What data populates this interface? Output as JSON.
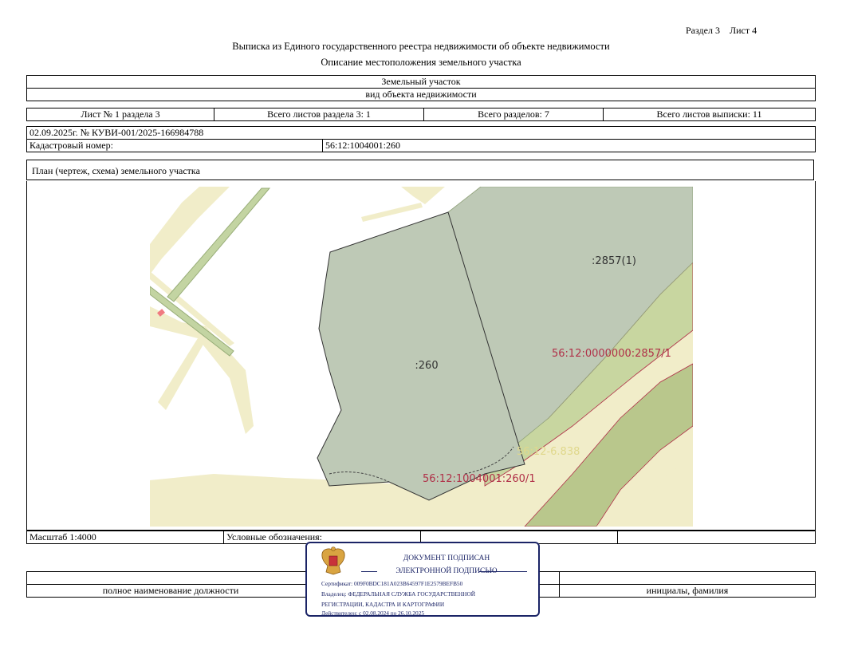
{
  "header": {
    "section": "Раздел 3",
    "sheet": "Лист 4",
    "title": "Выписка из Единого государственного реестра недвижимости об объекте недвижимости",
    "subtitle": "Описание местоположения земельного участка"
  },
  "object": {
    "type": "Земельный участок",
    "type_caption": "вид объекта недвижимости"
  },
  "sheets": {
    "sheet_of_section": "Лист № 1 раздела 3",
    "total_sheets_section": "Всего листов раздела 3: 1",
    "total_sections": "Всего разделов: 7",
    "total_sheets_extract": "Всего листов выписки: 11"
  },
  "record": {
    "date_number": "02.09.2025г. № КУВИ-001/2025-166984788",
    "cadastral_label": "Кадастровый номер:",
    "cadastral_value": "56:12:1004001:260"
  },
  "plan": {
    "title": "План (чертеж, схема) земельного участка",
    "labels": {
      "parcel": ":260",
      "neighbor": ":2857(1)",
      "zone_big": "56:12:0000000:2857/1",
      "zone_small": "56:12-6.838",
      "zone_parcel": "56:12:1004001:260/1"
    },
    "colors": {
      "parcel_fill": "#bec9b6",
      "road_fill": "#efebc6",
      "green_band": "#c8d6a0",
      "label_red": "#b03048",
      "label_yellow": "#e8e2a8"
    }
  },
  "footer": {
    "scale": "Масштаб 1:4000",
    "legend": "Условные обозначения:",
    "position_caption": "полное наименование должности",
    "name_caption": "инициалы, фамилия"
  },
  "stamp": {
    "line1": "ДОКУМЕНТ ПОДПИСАН",
    "line2": "ЭЛЕКТРОННОЙ ПОДПИСЬЮ",
    "certificate": "Сертификат: 009F0BDC181A023B64597F1E2579BEFB50",
    "owner1": "Владелец: ФЕДЕРАЛЬНАЯ СЛУЖБА ГОСУДАРСТВЕННОЙ",
    "owner2": "РЕГИСТРАЦИИ, КАДАСТРА И КАРТОГРАФИИ",
    "valid": "Действителен: с 02.08.2024 по 26.10.2025"
  }
}
